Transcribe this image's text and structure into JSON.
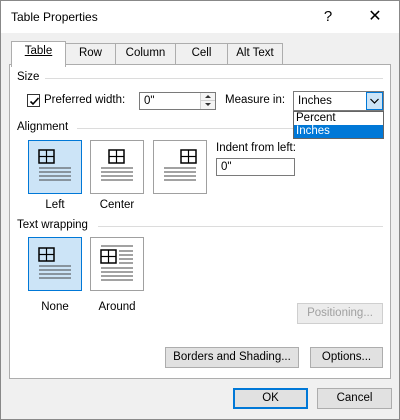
{
  "window": {
    "title": "Table Properties"
  },
  "titlebar": {
    "help_glyph": "?",
    "close_glyph": "✕"
  },
  "tabs": [
    {
      "label": "Table",
      "active": true
    },
    {
      "label": "Row"
    },
    {
      "label": "Column"
    },
    {
      "label": "Cell"
    },
    {
      "label": "Alt Text"
    }
  ],
  "size": {
    "group_label": "Size",
    "preferred_width_label": "Preferred width:",
    "preferred_width_checked": true,
    "preferred_width_value": "0\"",
    "measure_in_label": "Measure in:",
    "measure_in_value": "Inches",
    "measure_options": [
      "Percent",
      "Inches"
    ],
    "measure_selected_index": 1
  },
  "alignment": {
    "group_label": "Alignment",
    "options": [
      "Left",
      "Center",
      "Right"
    ],
    "selected": "Left",
    "indent_label": "Indent from left:",
    "indent_value": "0\""
  },
  "text_wrapping": {
    "group_label": "Text wrapping",
    "options": [
      "None",
      "Around"
    ],
    "selected": "None",
    "positioning_label": "Positioning..."
  },
  "buttons": {
    "borders_shading": "Borders and Shading...",
    "options": "Options...",
    "ok": "OK",
    "cancel": "Cancel"
  },
  "colors": {
    "accent": "#0078d7",
    "selected_tile_bg": "#cce4f7"
  },
  "icons": [
    "help-icon",
    "close-icon",
    "checkmark-icon",
    "spin-up-icon",
    "spin-down-icon",
    "dropdown-arrow-icon",
    "align-left-icon",
    "align-center-icon",
    "align-right-icon",
    "wrap-none-icon",
    "wrap-around-icon"
  ]
}
